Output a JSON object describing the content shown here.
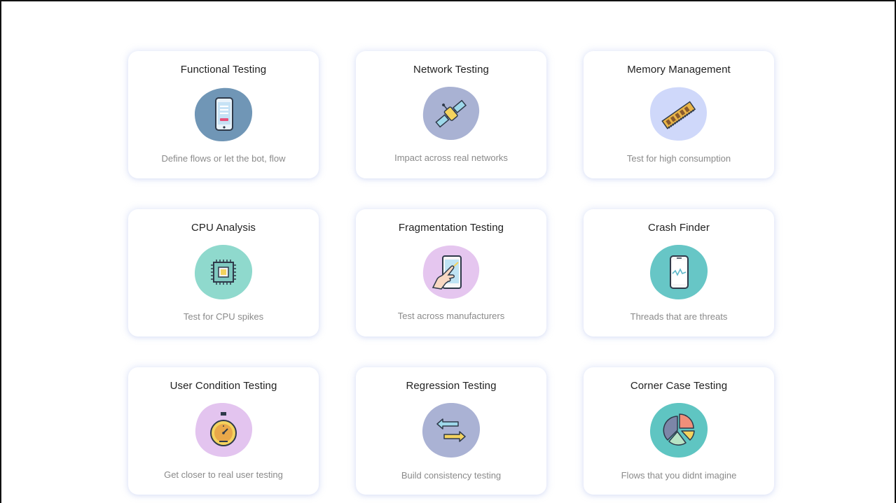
{
  "cards": [
    {
      "title": "Functional Testing",
      "description": "Define flows or let the bot, flow",
      "icon": "smartphone-icon",
      "color": "#7096b6"
    },
    {
      "title": "Network Testing",
      "description": "Impact across real networks",
      "icon": "satellite-icon",
      "color": "#a9b2d3"
    },
    {
      "title": "Memory Management",
      "description": "Test for high consumption",
      "icon": "ram-chip-icon",
      "color": "#cfd8fa"
    },
    {
      "title": "CPU Analysis",
      "description": "Test for CPU spikes",
      "icon": "cpu-chip-icon",
      "color": "#8fd9cd"
    },
    {
      "title": "Fragmentation Testing",
      "description": "Test across manufacturers",
      "icon": "hand-touch-phone-icon",
      "color": "#e5c6ef"
    },
    {
      "title": "Crash Finder",
      "description": "Threads that are threats",
      "icon": "phone-pulse-icon",
      "color": "#67c6c6"
    },
    {
      "title": "User Condition Testing",
      "description": "Get closer to real user testing",
      "icon": "stopwatch-icon",
      "color": "#e3c4ef"
    },
    {
      "title": "Regression Testing",
      "description": "Build consistency testing",
      "icon": "swap-arrows-icon",
      "color": "#aab2d4"
    },
    {
      "title": "Corner Case Testing",
      "description": "Flows that you didnt imagine",
      "icon": "pie-chart-icon",
      "color": "#5fc5c2"
    }
  ]
}
